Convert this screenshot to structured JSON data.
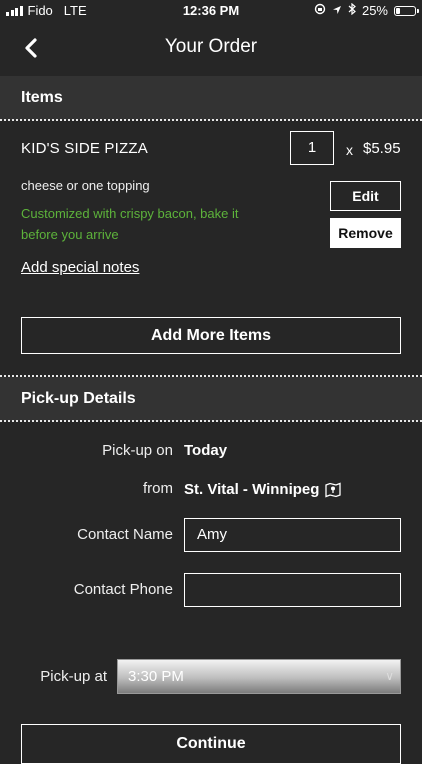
{
  "status_bar": {
    "carrier": "Fido",
    "network": "LTE",
    "time": "12:36 PM",
    "battery": "25%",
    "battery_level": 0.25
  },
  "nav": {
    "title": "Your Order",
    "back_icon": "chevron-left-icon"
  },
  "items_section": {
    "header": "Items",
    "item": {
      "name": "KID'S SIDE PIZZA",
      "quantity": "1",
      "times": "x",
      "price": "$5.95",
      "description": "cheese or one topping",
      "customization": "Customized with crispy bacon, bake it before you arrive",
      "edit_label": "Edit",
      "remove_label": "Remove",
      "notes_link": "Add special notes"
    },
    "add_more_label": "Add More Items"
  },
  "pickup_section": {
    "header": "Pick-up Details",
    "pickup_on_label": "Pick-up on",
    "pickup_on_value": "Today",
    "from_label": "from",
    "from_value": "St. Vital - Winnipeg",
    "location_icon": "map-icon",
    "contact_name_label": "Contact Name",
    "contact_name_value": "Amy",
    "contact_phone_label": "Contact Phone",
    "contact_phone_value": "",
    "pickup_at_label": "Pick-up at",
    "pickup_at_value": "3:30 PM"
  },
  "continue_label": "Continue",
  "colors": {
    "background": "#262626",
    "section_header": "#333333",
    "customization_text": "#5db33b"
  }
}
